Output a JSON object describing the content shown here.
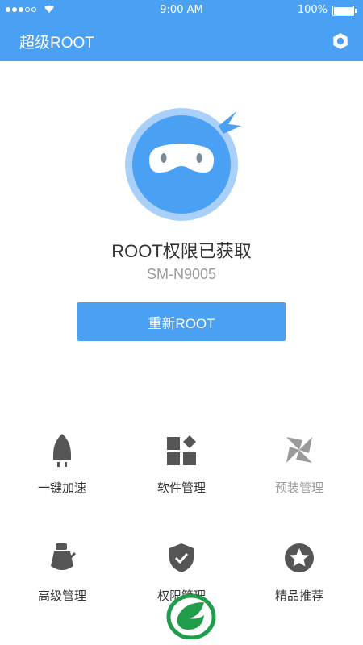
{
  "status_bar": {
    "carrier": "",
    "time": "9:00 AM",
    "battery": "100%",
    "battery_level": 1.0
  },
  "app_bar": {
    "title": "超级ROOT",
    "settings_icon": "gear-icon"
  },
  "root_status": {
    "title": "ROOT权限已获取",
    "device_model": "SM-N9005",
    "reroot_button": "重新ROOT"
  },
  "features": [
    {
      "label": "一键加速",
      "icon": "rocket-icon"
    },
    {
      "label": "软件管理",
      "icon": "apps-grid-icon"
    },
    {
      "label": "预装管理",
      "icon": "pinwheel-icon"
    },
    {
      "label": "高级管理",
      "icon": "tools-icon"
    },
    {
      "label": "权限管理",
      "icon": "shield-check-icon"
    },
    {
      "label": "精品推荐",
      "icon": "star-badge-icon"
    }
  ],
  "colors": {
    "primary": "#4aa0f2",
    "mascot_ring": "#a8d0f8",
    "icon_gray": "#555555",
    "icon_faded": "#9a9a9a",
    "logo_green": "#1f9d4a"
  }
}
